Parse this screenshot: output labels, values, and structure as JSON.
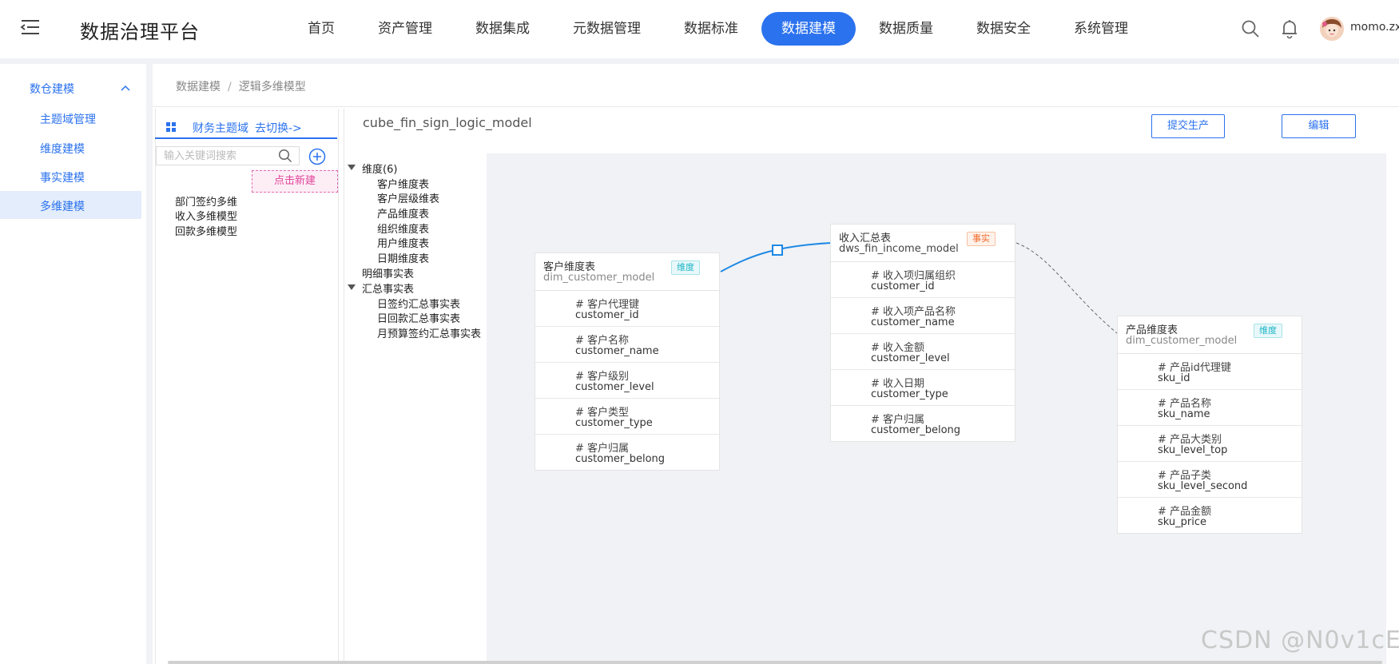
{
  "header": {
    "brand": "数据治理平台",
    "nav": [
      {
        "label": "首页",
        "active": false
      },
      {
        "label": "资产管理",
        "active": false
      },
      {
        "label": "数据集成",
        "active": false
      },
      {
        "label": "元数据管理",
        "active": false
      },
      {
        "label": "数据标准",
        "active": false
      },
      {
        "label": "数据建模",
        "active": true
      },
      {
        "label": "数据质量",
        "active": false
      },
      {
        "label": "数据安全",
        "active": false
      },
      {
        "label": "系统管理",
        "active": false
      }
    ],
    "username": "momo.zxy",
    "accent": "#2b72ee"
  },
  "sidebar": {
    "group": "数仓建模",
    "items": [
      "主题域管理",
      "维度建模",
      "事实建模",
      "多维建模"
    ],
    "active_index": 3
  },
  "breadcrumb": [
    "数据建模",
    "逻辑多维模型"
  ],
  "domain": {
    "name": "财务主题域",
    "switch_label": "去切换->"
  },
  "search": {
    "placeholder": "输入关键词搜索",
    "value": ""
  },
  "new_hint": "点击新建",
  "models": [
    "部门签约多维",
    "收入多维模型",
    "回款多维模型"
  ],
  "model_name": "cube_fin_sign_logic_model",
  "buttons": {
    "submit": "提交生产",
    "edit": "编辑"
  },
  "tree": {
    "dimension_group": "维度(6)",
    "dimension_items": [
      "客户维度表",
      "客户层级维表",
      "产品维度表",
      "组织维度表",
      "用户维度表",
      "日期维度表"
    ],
    "detail_fact": "明细事实表",
    "summary_group": "汇总事实表",
    "summary_items": [
      "日签约汇总事实表",
      "日回款汇总事实表",
      "月预算签约汇总事实表"
    ]
  },
  "cards": {
    "customer": {
      "title": "客户维度表",
      "table": "dim_customer_model",
      "tag": "维度",
      "fields": [
        {
          "cn": "# 客户代理键",
          "en": "customer_id"
        },
        {
          "cn": "# 客户名称",
          "en": "customer_name"
        },
        {
          "cn": "# 客户级别",
          "en": "customer_level"
        },
        {
          "cn": "# 客户类型",
          "en": "customer_type"
        },
        {
          "cn": "# 客户归属",
          "en": "customer_belong"
        }
      ]
    },
    "income": {
      "title": "收入汇总表",
      "table": "dws_fin_income_model",
      "tag": "事实",
      "fields": [
        {
          "cn": "# 收入项归属组织",
          "en": "customer_id"
        },
        {
          "cn": "# 收入项产品名称",
          "en": "customer_name"
        },
        {
          "cn": "# 收入金额",
          "en": "customer_level"
        },
        {
          "cn": "# 收入日期",
          "en": "customer_type"
        },
        {
          "cn": "# 客户归属",
          "en": "customer_belong"
        }
      ]
    },
    "product": {
      "title": "产品维度表",
      "table": "dim_customer_model",
      "tag": "维度",
      "fields": [
        {
          "cn": "# 产品id代理键",
          "en": "sku_id"
        },
        {
          "cn": "# 产品名称",
          "en": "sku_name"
        },
        {
          "cn": "# 产品大类别",
          "en": "sku_level_top"
        },
        {
          "cn": "# 产品子类",
          "en": "sku_level_second"
        },
        {
          "cn": "# 产品金额",
          "en": "sku_price"
        }
      ]
    }
  },
  "watermark": "CSDN @N0v1cE"
}
